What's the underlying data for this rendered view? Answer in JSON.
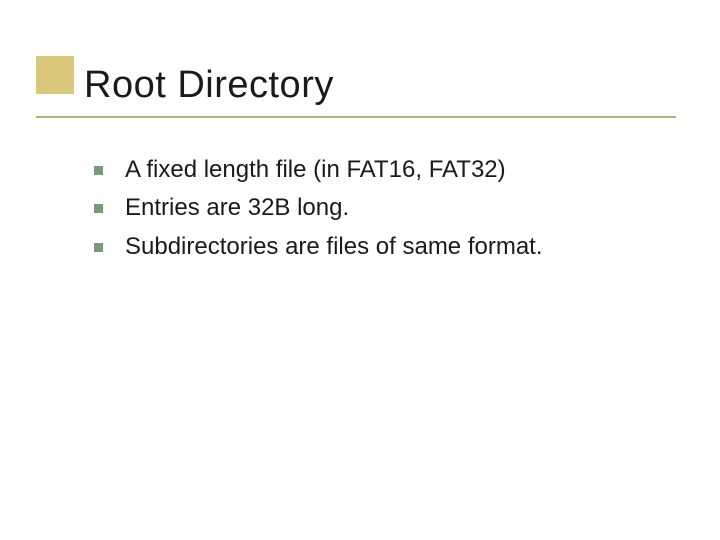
{
  "slide": {
    "title": "Root Directory",
    "bullets": [
      "A fixed length file (in FAT16, FAT32)",
      "Entries are 32B long.",
      "Subdirectories are files of same format."
    ]
  }
}
